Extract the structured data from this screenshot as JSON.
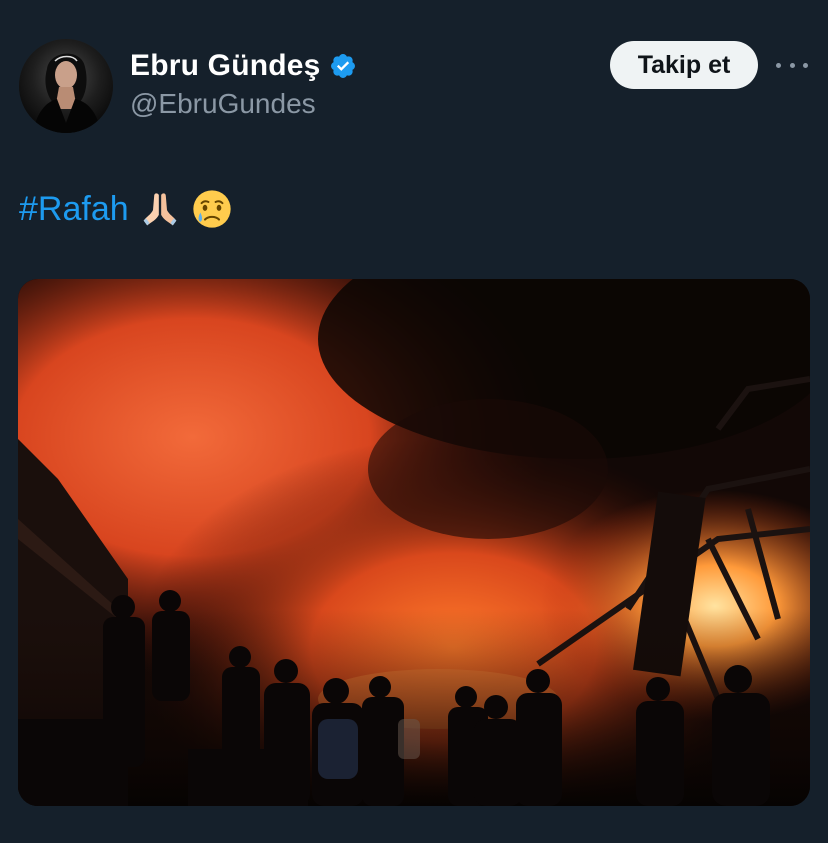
{
  "author": {
    "display_name": "Ebru Gündeş",
    "handle": "@EbruGundes",
    "verified": true,
    "avatar_icon": "profile-photo"
  },
  "actions": {
    "follow_label": "Takip et",
    "more_icon": "more-options-icon"
  },
  "tweet": {
    "hashtag": "#Rafah",
    "emojis": [
      "folded-hands",
      "crying-face"
    ]
  },
  "media": {
    "type": "photo",
    "icon": "photo"
  },
  "colors": {
    "background": "#15202b",
    "accent": "#1d9bf0",
    "secondary_text": "#8b98a5",
    "button_bg": "#eff3f4"
  }
}
